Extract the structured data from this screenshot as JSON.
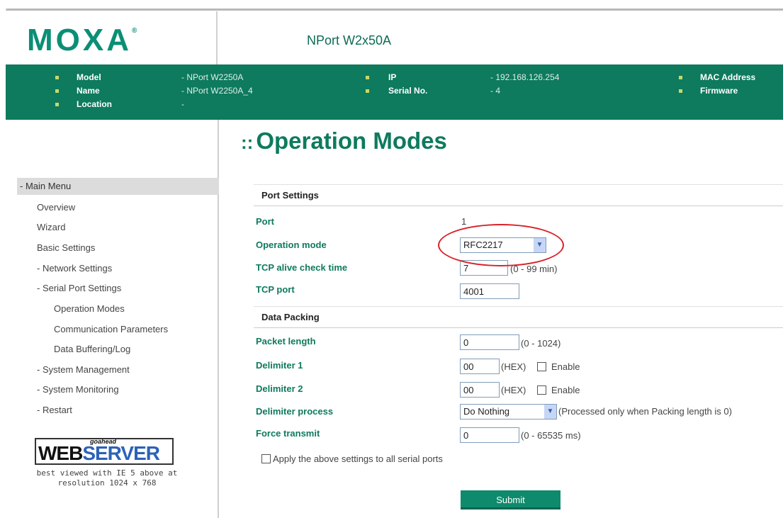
{
  "header": {
    "logo": "MOXA",
    "logo_mark": "®",
    "product": "NPort W2x50A"
  },
  "info": {
    "model_label": "Model",
    "model_value": "- NPort W2250A",
    "name_label": "Name",
    "name_value": "- NPort W2250A_4",
    "location_label": "Location",
    "location_value": "-",
    "ip_label": "IP",
    "ip_value": "- 192.168.126.254",
    "serial_label": "Serial No.",
    "serial_value": "- 4",
    "mac_label": "MAC Address",
    "firmware_label": "Firmware"
  },
  "sidebar": {
    "main_menu": "- Main Menu",
    "items": [
      "Overview",
      "Wizard",
      "Basic Settings",
      "- Network Settings",
      "- Serial Port Settings",
      "Operation Modes",
      "Communication Parameters",
      "Data Buffering/Log",
      "- System Management",
      "- System Monitoring",
      "- Restart"
    ],
    "web_tag": "goahead",
    "web_text_a": "WEB",
    "web_text_b": "SERVER",
    "web_note": "best viewed with IE 5 above at resolution 1024 x 768"
  },
  "page": {
    "title": "Operation Modes",
    "title_arrow": "::",
    "port_section": "Port Settings",
    "port_label": "Port",
    "port_value": "1",
    "op_mode_label": "Operation mode",
    "op_mode_value": "RFC2217",
    "tcp_alive_label": "TCP alive check time",
    "tcp_alive_value": "7",
    "tcp_alive_range": "(0 - 99 min)",
    "tcp_port_label": "TCP port",
    "tcp_port_value": "4001",
    "packing_section": "Data Packing",
    "packet_length_label": "Packet length",
    "packet_length_value": "0",
    "packet_length_range": "(0 - 1024)",
    "delim1_label": "Delimiter 1",
    "delim1_value": "00",
    "delim1_hex": "(HEX)",
    "delim1_enable": "Enable",
    "delim2_label": "Delimiter 2",
    "delim2_value": "00",
    "delim2_hex": "(HEX)",
    "delim2_enable": "Enable",
    "delim_process_label": "Delimiter process",
    "delim_process_value": "Do Nothing",
    "delim_process_note": "(Processed only when Packing length is 0)",
    "force_transmit_label": "Force transmit",
    "force_transmit_value": "0",
    "force_transmit_range": "(0 - 65535 ms)",
    "apply_all_label": "Apply the above settings to all serial ports",
    "submit_label": "Submit"
  },
  "colors": {
    "brand_green": "#0e7a5e",
    "annotation_red": "#d8232a"
  }
}
